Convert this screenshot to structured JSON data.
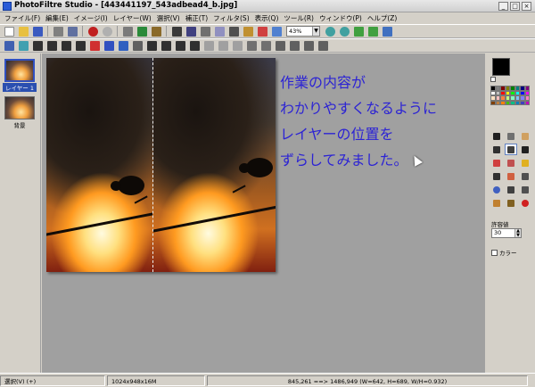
{
  "window": {
    "title": "PhotoFiltre Studio - [443441197_543adbead4_b.jpg]"
  },
  "menu": [
    "ファイル(F)",
    "編集(E)",
    "イメージ(I)",
    "レイヤー(W)",
    "選択(V)",
    "補正(T)",
    "フィルタ(S)",
    "表示(Q)",
    "ツール(R)",
    "ウィンドウ(P)",
    "ヘルプ(Z)"
  ],
  "toolbar": {
    "zoom_value": "43%"
  },
  "layers": [
    {
      "label": "レイヤー 1",
      "selected": true
    },
    {
      "label": "背景",
      "selected": false
    }
  ],
  "annotation": {
    "lines": [
      "作業の内容が",
      "わかりやすくなるように",
      "レイヤーの位置を",
      "ずらしてみました。"
    ],
    "color": "#2c23d4"
  },
  "right_panel": {
    "tolerance_label": "許容値",
    "tolerance_value": "30",
    "color_checkbox_label": "カラー"
  },
  "status": {
    "mode": "選択(V) (+)",
    "image_size": "1024x948x16M",
    "selection_info": "845,261 ==> 1486,949 (W=642, H=689, W/H=0.932)"
  },
  "colors": {
    "accent": "#3050c0",
    "workspace": "#a0a0a0",
    "chrome": "#d4d0c8"
  }
}
